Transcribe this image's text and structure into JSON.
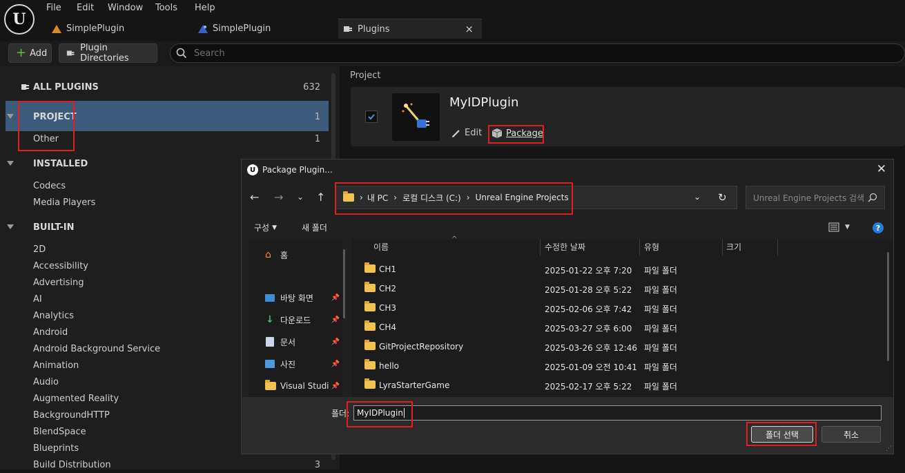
{
  "menu": [
    "File",
    "Edit",
    "Window",
    "Tools",
    "Help"
  ],
  "tabs": [
    {
      "label": "SimplePlugin",
      "icon": "blueprint-icon"
    },
    {
      "label": "SimplePlugin",
      "icon": "material-icon"
    },
    {
      "label": "Plugins",
      "icon": "plugin-icon",
      "close": "×"
    }
  ],
  "toolbar": {
    "add": "Add",
    "plugin_dirs": "Plugin Directories",
    "search_placeholder": "Search"
  },
  "left": {
    "all_plugins": {
      "label": "ALL PLUGINS",
      "count": "632"
    },
    "project": {
      "label": "PROJECT",
      "count": "1"
    },
    "other": {
      "label": "Other",
      "count": "1"
    },
    "installed": {
      "label": "INSTALLED"
    },
    "codecs": "Codecs",
    "media_players": "Media Players",
    "builtin": {
      "label": "BUILT-IN"
    },
    "builtin_items": [
      "2D",
      "Accessibility",
      "Advertising",
      "AI",
      "Analytics",
      "Android",
      "Android Background Service",
      "Animation",
      "Audio",
      "Augmented Reality",
      "BackgroundHTTP",
      "BlendSpace",
      "Blueprints",
      "Build Distribution"
    ],
    "build_distribution_count": "3"
  },
  "right": {
    "section": "Project",
    "plugin_name": "MyIDPlugin",
    "edit": "Edit",
    "package": "Package"
  },
  "dialog": {
    "title": "Package Plugin...",
    "breadcrumb": [
      "내 PC",
      "로컬 디스크 (C:)",
      "Unreal Engine Projects"
    ],
    "search_placeholder": "Unreal Engine Projects 검색",
    "organize": "구성",
    "new_folder": "새 폴더",
    "nav": {
      "home": "홈",
      "desktop": "바탕 화면",
      "downloads": "다운로드",
      "documents": "문서",
      "pictures": "사진",
      "visual_studio": "Visual Studio"
    },
    "columns": {
      "name": "이름",
      "modified": "수정한 날짜",
      "type": "유형",
      "size": "크기"
    },
    "files": [
      {
        "name": "CH1",
        "date": "2025-01-22 오후 7:20",
        "type": "파일 폴더"
      },
      {
        "name": "CH2",
        "date": "2025-01-28 오후 5:22",
        "type": "파일 폴더"
      },
      {
        "name": "CH3",
        "date": "2025-02-06 오후 7:42",
        "type": "파일 폴더"
      },
      {
        "name": "CH4",
        "date": "2025-03-27 오후 6:00",
        "type": "파일 폴더"
      },
      {
        "name": "GitProjectRepository",
        "date": "2025-03-26 오후 12:46",
        "type": "파일 폴더"
      },
      {
        "name": "hello",
        "date": "2025-01-09 오전 10:41",
        "type": "파일 폴더"
      },
      {
        "name": "LyraStarterGame",
        "date": "2025-02-17 오후 5:22",
        "type": "파일 폴더"
      }
    ],
    "folder_label": "폴더:",
    "folder_value": "MyIDPlugin",
    "select_folder": "폴더 선택",
    "cancel": "취소"
  },
  "colors": {
    "highlight": "#e02020",
    "selected_row": "#3c5a7a",
    "folder": "#f2c14e"
  }
}
